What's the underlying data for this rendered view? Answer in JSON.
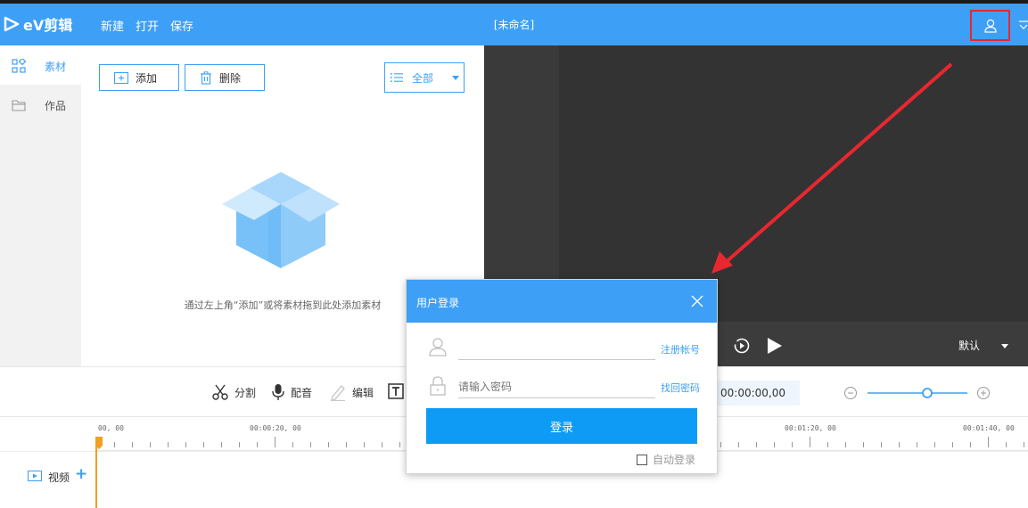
{
  "app": {
    "logo_text": "eV剪辑",
    "document_title": "[未命名]"
  },
  "menu": {
    "new": "新建",
    "open": "打开",
    "save": "保存"
  },
  "sidenav": [
    {
      "label": "素材",
      "icon": "grid-icon",
      "active": true
    },
    {
      "label": "作品",
      "icon": "folder-icon",
      "active": false
    }
  ],
  "material": {
    "add_label": "添加",
    "delete_label": "删除",
    "filter_label": "全部",
    "empty_hint": "通过左上角“添加”或将素材拖到此处添加素材"
  },
  "player": {
    "ratio_label": "默认"
  },
  "toolbar": {
    "split": "分割",
    "dub": "配音",
    "edit": "编辑",
    "timecode": "00:00:00,00"
  },
  "timeline": {
    "ruler_labels": [
      "00, 00",
      "00:00:20, 00",
      "00:01:20, 00",
      "00:01:40, 00"
    ],
    "video_track_label": "视频"
  },
  "login_dialog": {
    "title": "用户登录",
    "username_value": "",
    "password_placeholder": "请输入密码",
    "register_link": "注册帐号",
    "recover_link": "找回密码",
    "login_button": "登录",
    "auto_login_label": "自动登录"
  },
  "colors": {
    "primary": "#3e9ff6",
    "highlight": "#e8272f",
    "arrow": "#e8272f"
  }
}
